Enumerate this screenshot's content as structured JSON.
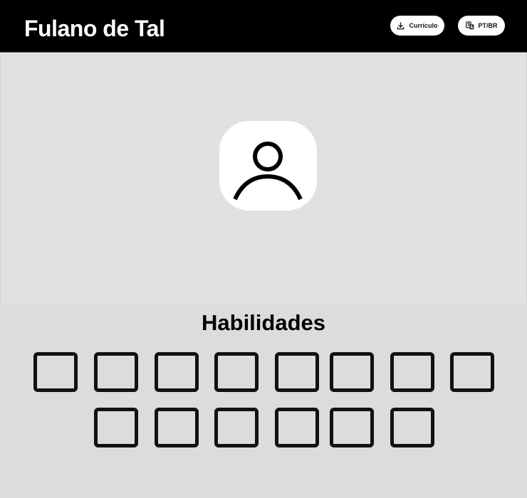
{
  "header": {
    "name": "Fulano de Tal",
    "cv_button_label": "Currículo",
    "lang_button_label": "PT/BR"
  },
  "hero": {
    "avatar_icon": "user-icon"
  },
  "skills": {
    "title": "Habilidades",
    "row1_count": 8,
    "row2_count": 6
  }
}
